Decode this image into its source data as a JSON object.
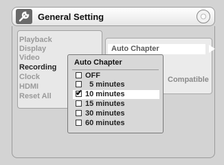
{
  "header": {
    "title": "General Setting",
    "icon": "wrench-icon",
    "disc_icon": "disc-icon"
  },
  "left_menu": {
    "items": [
      {
        "label": "Playback",
        "active": false
      },
      {
        "label": "Display",
        "active": false
      },
      {
        "label": "Video",
        "active": false
      },
      {
        "label": "Recording",
        "active": true
      },
      {
        "label": "Clock",
        "active": false
      },
      {
        "label": "HDMI",
        "active": false
      },
      {
        "label": "Reset All",
        "active": false
      }
    ]
  },
  "right_panel": {
    "highlighted_item": "Auto Chapter",
    "partial_text": "Compatible"
  },
  "popup": {
    "title": "Auto Chapter",
    "options": [
      {
        "label": "OFF",
        "checked": false,
        "selected": false
      },
      {
        "label": "  5 minutes",
        "checked": false,
        "selected": false
      },
      {
        "label": "10 minutes",
        "checked": true,
        "selected": true
      },
      {
        "label": "15 minutes",
        "checked": false,
        "selected": false
      },
      {
        "label": "30 minutes",
        "checked": false,
        "selected": false
      },
      {
        "label": "60 minutes",
        "checked": false,
        "selected": false
      }
    ],
    "check_glyph": "✔"
  }
}
